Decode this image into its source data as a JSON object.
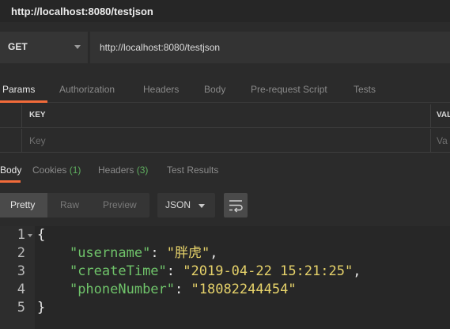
{
  "window": {
    "title": "http://localhost:8080/testjson"
  },
  "request": {
    "method": "GET",
    "url": "http://localhost:8080/testjson"
  },
  "request_tabs": [
    {
      "label": "Params",
      "active": true
    },
    {
      "label": "Authorization"
    },
    {
      "label": "Headers"
    },
    {
      "label": "Body"
    },
    {
      "label": "Pre-request Script"
    },
    {
      "label": "Tests"
    }
  ],
  "params_table": {
    "headers": {
      "key": "KEY",
      "value": "VAL"
    },
    "row": {
      "key_placeholder": "Key",
      "value_placeholder": "Va"
    }
  },
  "response_tabs": [
    {
      "label": "Body",
      "active": true
    },
    {
      "label": "Cookies",
      "count": "(1)"
    },
    {
      "label": "Headers",
      "count": "(3)"
    },
    {
      "label": "Test Results"
    }
  ],
  "view_modes": {
    "pretty": "Pretty",
    "raw": "Raw",
    "preview": "Preview"
  },
  "format": {
    "selected": "JSON"
  },
  "editor": {
    "line_numbers": [
      "1",
      "2",
      "3",
      "4",
      "5"
    ],
    "open_brace": "{",
    "close_brace": "}",
    "fields": [
      {
        "key": "\"username\"",
        "value": "\"胖虎\"",
        "trailing": ","
      },
      {
        "key": "\"createTime\"",
        "value": "\"2019-04-22 15:21:25\"",
        "trailing": ","
      },
      {
        "key": "\"phoneNumber\"",
        "value": "\"18082244454\"",
        "trailing": ""
      }
    ]
  },
  "colors": {
    "accent": "#f26b3a",
    "json_key": "#6fc36a",
    "json_string": "#e6d26a",
    "count": "#5fae5f"
  }
}
